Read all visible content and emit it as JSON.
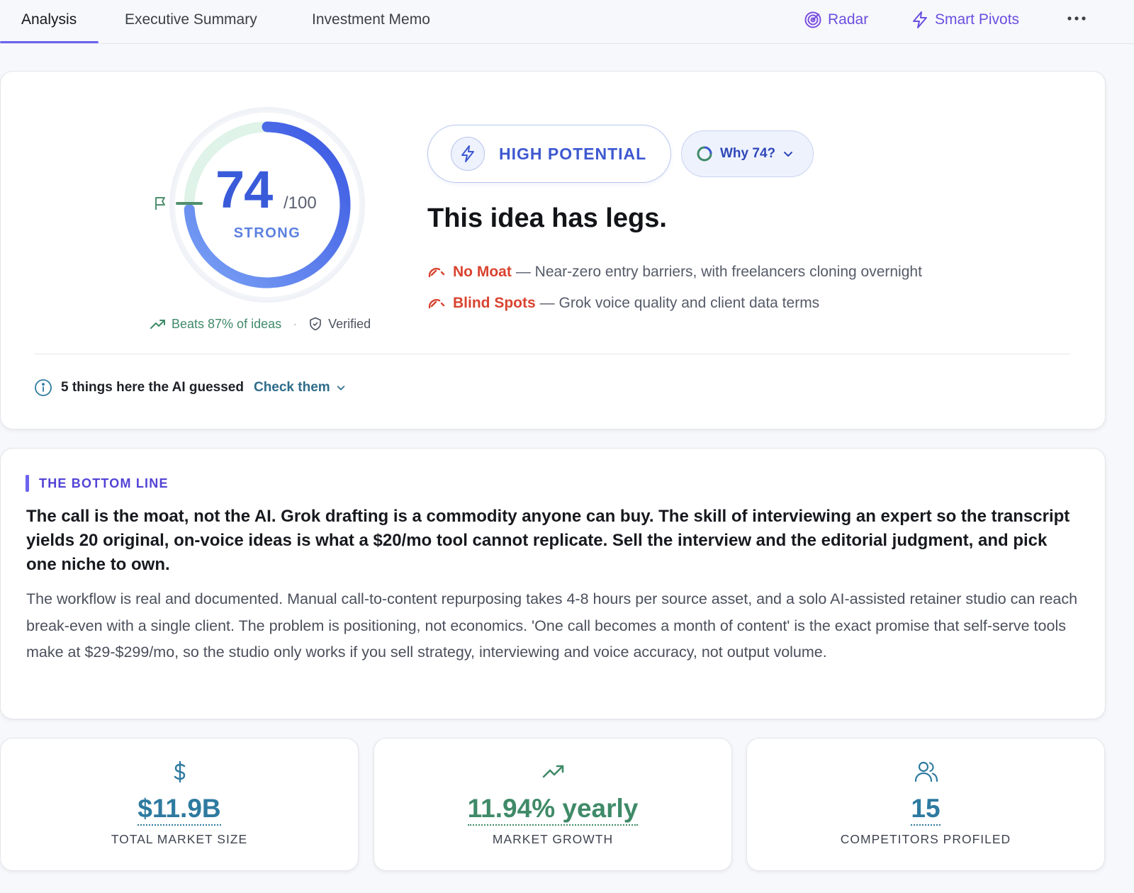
{
  "tabs": [
    {
      "label": "Analysis",
      "active": true
    },
    {
      "label": "Executive Summary",
      "active": false
    },
    {
      "label": "Investment Memo",
      "active": false
    }
  ],
  "top_actions": {
    "radar": {
      "label": "Radar",
      "icon": "radar-icon"
    },
    "smart_pivots": {
      "label": "Smart Pivots",
      "icon": "lightning-icon"
    },
    "more": {
      "label": "•••",
      "icon": "more-horizontal-icon"
    }
  },
  "score": {
    "value": "74",
    "max": "/100",
    "fraction": 0.74,
    "label": "STRONG",
    "beats": "Beats 87% of ideas",
    "verified": "Verified"
  },
  "badge": {
    "label": "HIGH POTENTIAL",
    "icon": "lightning-icon"
  },
  "why_button": {
    "label": "Why 74?"
  },
  "headline": "This idea has legs.",
  "risks": [
    {
      "name": "No Moat",
      "text": " — Near-zero entry barriers, with freelancers cloning overnight"
    },
    {
      "name": "Blind Spots",
      "text": " — Grok voice quality and client data terms"
    }
  ],
  "guesses": {
    "text": "5 things here the AI guessed",
    "link": "Check them"
  },
  "bottom_line": {
    "title": "THE BOTTOM LINE",
    "lead": "The call is the moat, not the AI. Grok drafting is a commodity anyone can buy. The skill of interviewing an expert so the transcript yields 20 original, on-voice ideas is what a $20/mo tool cannot replicate. Sell the interview and the editorial judgment, and pick one niche to own.",
    "body": "The workflow is real and documented. Manual call-to-content repurposing takes 4-8 hours per source asset, and a solo AI-assisted retainer studio can reach break-even with a single client. The problem is positioning, not economics. 'One call becomes a month of content' is the exact promise that self-serve tools make at $29-$299/mo, so the studio only works if you sell strategy, interviewing and voice accuracy, not output volume."
  },
  "stats": [
    {
      "value": "$11.9B",
      "label": "TOTAL MARKET SIZE",
      "icon": "dollar-icon"
    },
    {
      "value": "11.94% yearly",
      "label": "MARKET GROWTH",
      "icon": "trending-up-icon"
    },
    {
      "value": "15",
      "label": "COMPETITORS PROFILED",
      "icon": "users-icon"
    }
  ],
  "colors": {
    "accent": "#6c63f0",
    "score_blue": "#3a5bd9",
    "risk_red": "#d9432f",
    "growth_green": "#3f8a68",
    "stat_blue": "#2e7aa0"
  }
}
